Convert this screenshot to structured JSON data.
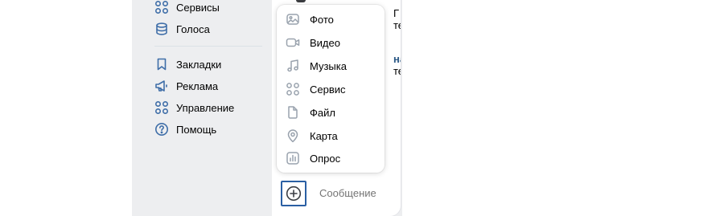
{
  "sidebar": {
    "items": [
      {
        "label": "Сервисы",
        "icon": "services-grid-icon"
      },
      {
        "label": "Голоса",
        "icon": "votes-coins-icon"
      },
      {
        "label": "Закладки",
        "icon": "bookmark-icon"
      },
      {
        "label": "Реклама",
        "icon": "megaphone-icon"
      },
      {
        "label": "Управление",
        "icon": "manage-grid-icon"
      },
      {
        "label": "Помощь",
        "icon": "help-question-icon"
      }
    ]
  },
  "chat": {
    "peek_lines": [
      "Г",
      "те",
      "на",
      "те"
    ]
  },
  "attach_menu": {
    "items": [
      {
        "label": "Фото",
        "icon": "photo-icon"
      },
      {
        "label": "Видео",
        "icon": "video-icon"
      },
      {
        "label": "Музыка",
        "icon": "music-icon"
      },
      {
        "label": "Сервис",
        "icon": "service-grid-icon"
      },
      {
        "label": "Файл",
        "icon": "file-icon"
      },
      {
        "label": "Карта",
        "icon": "map-pin-icon"
      },
      {
        "label": "Опрос",
        "icon": "poll-chart-icon"
      }
    ]
  },
  "composer": {
    "attach_icon": "plus-circle-icon",
    "placeholder": "Сообщение"
  },
  "colors": {
    "accent": "#2a5fa3",
    "sidebar_icon": "#3f6ea8",
    "menu_icon": "#99a2ad",
    "sidebar_bg": "#edeef0",
    "placeholder": "#818c99"
  }
}
